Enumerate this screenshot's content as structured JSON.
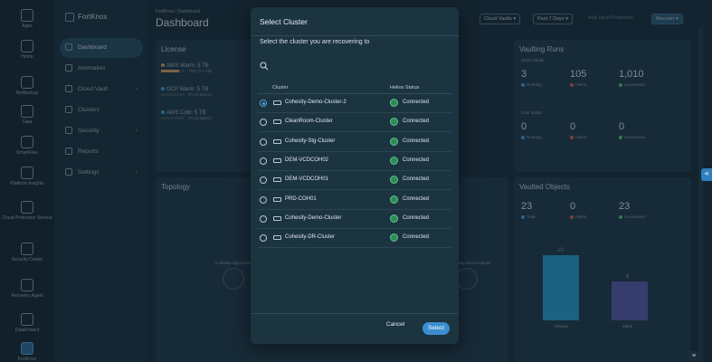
{
  "rail": [
    {
      "label": "Apps",
      "icon": "apps-icon"
    },
    {
      "label": "Home",
      "icon": "home-icon"
    },
    {
      "label": "NetBackup",
      "icon": "netbackup-icon"
    },
    {
      "label": "Gaia",
      "icon": "gaia-icon"
    },
    {
      "label": "SmartFiles",
      "icon": "smartfiles-icon"
    },
    {
      "label": "Platform Insights",
      "icon": "insights-icon"
    },
    {
      "label": "Cloud Protection Service",
      "icon": "cloud-protection-icon"
    },
    {
      "label": "Security Center",
      "icon": "security-center-icon"
    },
    {
      "label": "Recovery Agent",
      "icon": "recovery-agent-icon"
    },
    {
      "label": "DataProtect",
      "icon": "dataprotect-icon"
    },
    {
      "label": "FortKnox",
      "icon": "fortknox-icon"
    }
  ],
  "sidebar": {
    "brand": "FortKnox",
    "items": [
      {
        "label": "Dashboard",
        "active": true,
        "chevron": false
      },
      {
        "label": "Anomalies",
        "active": false,
        "chevron": false
      },
      {
        "label": "Cloud Vault",
        "active": false,
        "chevron": true
      },
      {
        "label": "Clusters",
        "active": false,
        "chevron": false
      },
      {
        "label": "Security",
        "active": false,
        "chevron": true
      },
      {
        "label": "Reports",
        "active": false,
        "chevron": false
      },
      {
        "label": "Settings",
        "active": false,
        "chevron": true
      }
    ]
  },
  "header": {
    "breadcrumb": "FortKnox / Dashboard",
    "title": "Dashboard",
    "filter_vaults": "Cloud Vaults",
    "filter_range": "Past 7 Days",
    "add_vault": "Add Vault Protection",
    "recover": "Recover"
  },
  "license": {
    "title": "License",
    "rows": [
      {
        "label": "AWS Warm: 5 TB",
        "sub": "78% (3.9 TB)",
        "fill": 0.78,
        "color": "#d9a36a"
      },
      {
        "label": "GCP Warm: 5 TB",
        "sub": "0% (0 Bytes)",
        "fill": 0.0,
        "color": "#4ea3de"
      },
      {
        "label": "AWS Cold: 5 TB",
        "sub": "0% (0 Bytes)",
        "fill": 0.0,
        "color": "#4ea3de"
      }
    ]
  },
  "vaulting_runs": {
    "title": "Vaulting Runs",
    "warm_label": "Warm Vaults",
    "cold_label": "Cold Vaults",
    "warm": [
      {
        "value": "3",
        "label": "Running"
      },
      {
        "value": "105",
        "label": "Failed"
      },
      {
        "value": "1,010",
        "label": "Succeeded"
      }
    ],
    "cold": [
      {
        "value": "0",
        "label": "Running"
      },
      {
        "value": "0",
        "label": "Failed"
      },
      {
        "value": "0",
        "label": "Succeeded"
      }
    ]
  },
  "vaulted_objects": {
    "title": "Vaulted Objects",
    "stats": [
      {
        "value": "23",
        "label": "Total"
      },
      {
        "value": "0",
        "label": "Failed"
      },
      {
        "value": "23",
        "label": "Succeeded"
      }
    ],
    "bars": [
      {
        "label": "VMware",
        "value": 10,
        "color": "#2b9fd6"
      },
      {
        "label": "M365",
        "value": 6,
        "color": "#5a5fb0"
      }
    ]
  },
  "topology": {
    "title": "Topology",
    "left_label": "Cohesity-Stg-Cluster",
    "right_label": "Cohesity-Demo-Cluster"
  },
  "modal": {
    "title": "Select Cluster",
    "subtitle": "Select the cluster you are recovering to",
    "col_cluster": "Cluster",
    "col_status": "Helios Status",
    "rows": [
      {
        "name": "Cohesity-Demo-Cluster-2",
        "status": "Connected",
        "selected": true
      },
      {
        "name": "CleanRoom-Cluster",
        "status": "Connected",
        "selected": false
      },
      {
        "name": "Cohesity-Stg-Cluster",
        "status": "Connected",
        "selected": false
      },
      {
        "name": "DEM-VCDCOH02",
        "status": "Connected",
        "selected": false
      },
      {
        "name": "DEM-VCDCOH01",
        "status": "Connected",
        "selected": false
      },
      {
        "name": "PRD-COH01",
        "status": "Connected",
        "selected": false
      },
      {
        "name": "Cohesity-Demo-Cluster",
        "status": "Connected",
        "selected": false
      },
      {
        "name": "Cohesity-DR-Cluster",
        "status": "Connected",
        "selected": false
      }
    ],
    "cancel": "Cancel",
    "select": "Select"
  }
}
